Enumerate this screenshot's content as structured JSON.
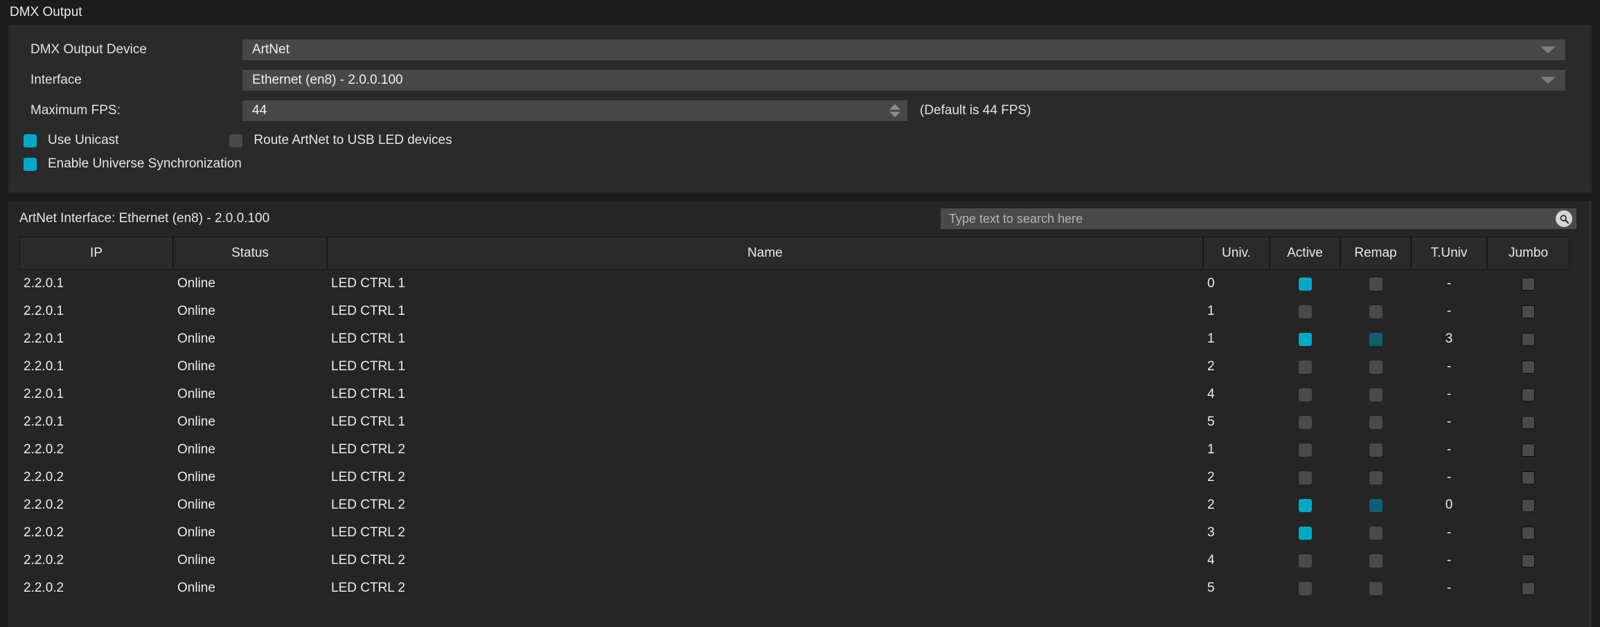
{
  "window": {
    "title": "DMX Output"
  },
  "settings": {
    "device_label": "DMX Output Device",
    "device_value": "ArtNet",
    "interface_label": "Interface",
    "interface_value": "Ethernet (en8) - 2.0.0.100",
    "fps_label": "Maximum FPS:",
    "fps_value": "44",
    "fps_note": "(Default is 44 FPS)",
    "use_unicast_label": "Use Unicast",
    "use_unicast_checked": true,
    "route_artnet_label": "Route ArtNet to USB LED devices",
    "route_artnet_checked": false,
    "enable_sync_label": "Enable Universe Synchronization",
    "enable_sync_checked": true,
    "dropdown_icon": "chevron-down-icon",
    "spinner_icon": "stepper-icon"
  },
  "list": {
    "interface_title": "ArtNet Interface: Ethernet (en8) - 2.0.0.100",
    "search_placeholder": "Type text to search here",
    "search_value": "",
    "search_icon": "search-icon",
    "columns": [
      "IP",
      "Status",
      "Name",
      "Univ.",
      "Active",
      "Remap",
      "T.Univ",
      "Jumbo"
    ],
    "rows": [
      {
        "ip": "2.2.0.1",
        "status": "Online",
        "name": "LED CTRL 1",
        "univ": "0",
        "active": true,
        "remap": false,
        "tuniv": "-",
        "jumbo": false
      },
      {
        "ip": "2.2.0.1",
        "status": "Online",
        "name": "LED CTRL 1",
        "univ": "1",
        "active": false,
        "remap": false,
        "tuniv": "-",
        "jumbo": false
      },
      {
        "ip": "2.2.0.1",
        "status": "Online",
        "name": "LED CTRL 1",
        "univ": "1",
        "active": true,
        "remap": true,
        "tuniv": "3",
        "jumbo": false
      },
      {
        "ip": "2.2.0.1",
        "status": "Online",
        "name": "LED CTRL 1",
        "univ": "2",
        "active": false,
        "remap": false,
        "tuniv": "-",
        "jumbo": false
      },
      {
        "ip": "2.2.0.1",
        "status": "Online",
        "name": "LED CTRL 1",
        "univ": "4",
        "active": false,
        "remap": false,
        "tuniv": "-",
        "jumbo": false
      },
      {
        "ip": "2.2.0.1",
        "status": "Online",
        "name": "LED CTRL 1",
        "univ": "5",
        "active": false,
        "remap": false,
        "tuniv": "-",
        "jumbo": false
      },
      {
        "ip": "2.2.0.2",
        "status": "Online",
        "name": "LED CTRL 2",
        "univ": "1",
        "active": false,
        "remap": false,
        "tuniv": "-",
        "jumbo": false
      },
      {
        "ip": "2.2.0.2",
        "status": "Online",
        "name": "LED CTRL 2",
        "univ": "2",
        "active": false,
        "remap": false,
        "tuniv": "-",
        "jumbo": false
      },
      {
        "ip": "2.2.0.2",
        "status": "Online",
        "name": "LED CTRL 2",
        "univ": "2",
        "active": true,
        "remap": true,
        "tuniv": "0",
        "jumbo": false
      },
      {
        "ip": "2.2.0.2",
        "status": "Online",
        "name": "LED CTRL 2",
        "univ": "3",
        "active": true,
        "remap": false,
        "tuniv": "-",
        "jumbo": false
      },
      {
        "ip": "2.2.0.2",
        "status": "Online",
        "name": "LED CTRL 2",
        "univ": "4",
        "active": false,
        "remap": false,
        "tuniv": "-",
        "jumbo": false
      },
      {
        "ip": "2.2.0.2",
        "status": "Online",
        "name": "LED CTRL 2",
        "univ": "5",
        "active": false,
        "remap": false,
        "tuniv": "-",
        "jumbo": false
      }
    ]
  },
  "colors": {
    "accent": "#00a9c7",
    "accent_dark": "#0d5f70",
    "panel": "#2a2a2a",
    "panel_alt": "#252525",
    "field": "#474747",
    "background": "#1b1b1b"
  }
}
